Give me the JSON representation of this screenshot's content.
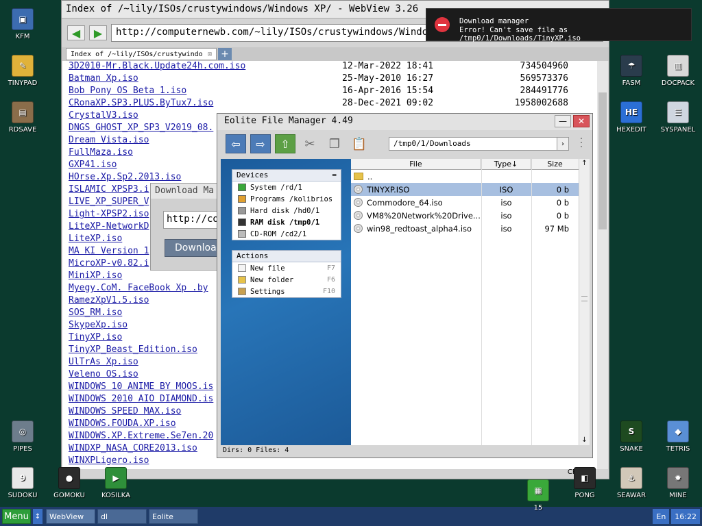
{
  "desktop": {
    "icons_left": [
      {
        "label": "KFM",
        "color": "#3c6cb0",
        "glyph": "▣"
      },
      {
        "label": "TINYPAD",
        "color": "#e0b23a",
        "glyph": "✎"
      },
      {
        "label": "RDSAVE",
        "color": "#8a6d4a",
        "glyph": "▤"
      },
      {
        "label": "PIPES",
        "color": "#6d7d8c",
        "glyph": "◎"
      },
      {
        "label": "SUDOKU",
        "color": "#e8e8e8",
        "glyph": "9"
      },
      {
        "label": "GOMOKU",
        "color": "#2b2b2b",
        "glyph": "●"
      },
      {
        "label": "KOSILKA",
        "color": "#2f8f3a",
        "glyph": "▶"
      }
    ],
    "icons_right": [
      {
        "label": "FASM",
        "color": "#2a3c4c",
        "glyph": "☂"
      },
      {
        "label": "DOCPACK",
        "color": "#d9d9d9",
        "glyph": "▥"
      },
      {
        "label": "HEXEDIT",
        "color": "#2b6fd6",
        "glyph": "HE"
      },
      {
        "label": "SYSPANEL",
        "color": "#cfd6e0",
        "glyph": "☰"
      },
      {
        "label": "SNAKE",
        "color": "#1e4a20",
        "glyph": "S"
      },
      {
        "label": "TETRIS",
        "color": "#5a8fd6",
        "glyph": "◆"
      },
      {
        "label": "15",
        "color": "#3aa83a",
        "glyph": "▦"
      },
      {
        "label": "PONG",
        "color": "#2a2a2a",
        "glyph": "◧"
      },
      {
        "label": "SEAWAR",
        "color": "#d2c8b8",
        "glyph": "⚓"
      },
      {
        "label": "MINE",
        "color": "#777777",
        "glyph": "✹"
      }
    ]
  },
  "webview": {
    "title": "Index of /~lily/ISOs/crustywindows/Windows XP/ - WebView 3.26",
    "url": "http://computernewb.com/~lily/ISOs/crustywindows/Windows",
    "tab_label": "Index of /~lily/ISOs/crustywindo",
    "files": [
      {
        "name": "3D2010-Mr.Black.Update24h.com.iso",
        "date": "12-Mar-2022 18:41",
        "size": "734504960"
      },
      {
        "name": "Batman Xp.iso",
        "date": "25-May-2010 16:27",
        "size": "569573376"
      },
      {
        "name": "Bob Pony OS Beta 1.iso",
        "date": "16-Apr-2016 15:54",
        "size": "284491776"
      },
      {
        "name": "CRonaXP.SP3.PLUS.ByTux7.iso",
        "date": "28-Dec-2021 09:02",
        "size": "1958002688"
      },
      {
        "name": "CrystalV3.iso",
        "date": "",
        "size": ""
      },
      {
        "name": "DNGS_GHOST_XP_SP3_V2019_08.",
        "date": "",
        "size": ""
      },
      {
        "name": "Dream Vista.iso",
        "date": "",
        "size": ""
      },
      {
        "name": "FullMaza.iso",
        "date": "",
        "size": ""
      },
      {
        "name": "GXP41.iso",
        "date": "",
        "size": ""
      },
      {
        "name": "HOrse.Xp.Sp2.2013.iso",
        "date": "",
        "size": ""
      },
      {
        "name": "ISLAMIC XPSP3.i",
        "date": "",
        "size": ""
      },
      {
        "name": "LIVE_XP_SUPER_V",
        "date": "",
        "size": ""
      },
      {
        "name": "Light-XPSP2.iso",
        "date": "",
        "size": ""
      },
      {
        "name": "LiteXP-NetworkD",
        "date": "",
        "size": ""
      },
      {
        "name": "LiteXP.iso",
        "date": "",
        "size": ""
      },
      {
        "name": "MA KI Version 1",
        "date": "",
        "size": ""
      },
      {
        "name": "MicroXP-v0.82.i",
        "date": "",
        "size": ""
      },
      {
        "name": "MiniXP.iso",
        "date": "",
        "size": ""
      },
      {
        "name": "Myegy.CoM. FaceBook Xp .by",
        "date": "",
        "size": ""
      },
      {
        "name": "RamezXpV1.5.iso",
        "date": "",
        "size": ""
      },
      {
        "name": "SOS_RM.iso",
        "date": "",
        "size": ""
      },
      {
        "name": "SkypeXp.iso",
        "date": "",
        "size": ""
      },
      {
        "name": "TinyXP.iso",
        "date": "",
        "size": ""
      },
      {
        "name": "TinyXP_Beast_Edition.iso",
        "date": "",
        "size": ""
      },
      {
        "name": "UlTrAs Xp.iso",
        "date": "",
        "size": ""
      },
      {
        "name": "Veleno OS.iso",
        "date": "",
        "size": ""
      },
      {
        "name": "WINDOWS 10 ANIME BY MOOS.is",
        "date": "",
        "size": ""
      },
      {
        "name": "WINDOWS 2010 AIO DIAMOND.is",
        "date": "",
        "size": ""
      },
      {
        "name": "WINDOWS SPEED MAX.iso",
        "date": "",
        "size": ""
      },
      {
        "name": "WINDOWS.FOUDA.XP.iso",
        "date": "",
        "size": ""
      },
      {
        "name": "WINDOWS.XP.Extreme.Se7en.20",
        "date": "",
        "size": ""
      },
      {
        "name": "WINDXP_NASA_CORE2013.iso",
        "date": "",
        "size": ""
      },
      {
        "name": "WINXPLigero.iso",
        "date": "",
        "size": ""
      }
    ],
    "status": "CP866"
  },
  "download_dialog": {
    "title": "Download Ma",
    "url": "http://co",
    "button": "Downloa"
  },
  "eolite": {
    "title": "Eolite File Manager 4.49",
    "path": "/tmp0/1/Downloads",
    "devices_header": "Devices",
    "devices": [
      {
        "label": "System /rd/1",
        "bold": false,
        "color": "#3aa83a"
      },
      {
        "label": "Programs /kolibrios",
        "bold": false,
        "color": "#e0a030"
      },
      {
        "label": "Hard disk /hd0/1",
        "bold": false,
        "color": "#999999"
      },
      {
        "label": "RAM disk /tmp0/1",
        "bold": true,
        "color": "#333333"
      },
      {
        "label": "CD-ROM /cd2/1",
        "bold": false,
        "color": "#bbbbbb"
      }
    ],
    "actions_header": "Actions",
    "actions": [
      {
        "label": "New file",
        "key": "F7"
      },
      {
        "label": "New folder",
        "key": "F6"
      },
      {
        "label": "Settings",
        "key": "F10"
      }
    ],
    "columns": {
      "file": "File",
      "type": "Type↓",
      "size": "Size"
    },
    "rows": [
      {
        "name": "..",
        "type": "",
        "size": "",
        "kind": "up",
        "selected": false
      },
      {
        "name": "TINYXP.ISO",
        "type": "ISO",
        "size": "0 b",
        "kind": "disc",
        "selected": true
      },
      {
        "name": "Commodore_64.iso",
        "type": "iso",
        "size": "0 b",
        "kind": "disc",
        "selected": false
      },
      {
        "name": "VM8%20Network%20Drive...",
        "type": "iso",
        "size": "0 b",
        "kind": "disc",
        "selected": false
      },
      {
        "name": "win98_redtoast_alpha4.iso",
        "type": "iso",
        "size": "97 Mb",
        "kind": "disc",
        "selected": false
      }
    ],
    "status": "Dirs: 0  Files: 4"
  },
  "notification": {
    "title": "Download manager",
    "message": "Error! Can't save file as /tmp0/1/Downloads/TinyXP.iso"
  },
  "taskbar": {
    "menu": "Menu",
    "tasks": [
      "WebView",
      "dl",
      "Eolite"
    ],
    "lang": "En",
    "clock": "16:22"
  }
}
